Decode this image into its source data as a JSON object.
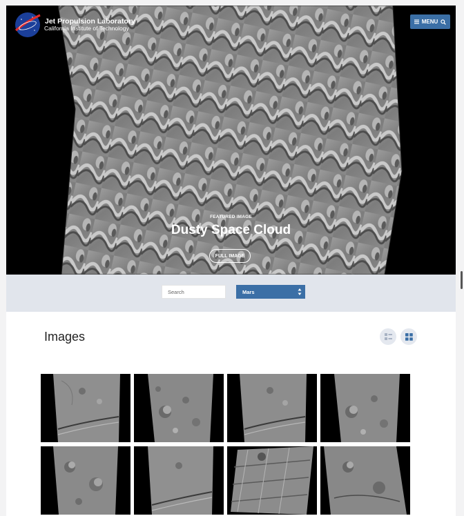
{
  "header": {
    "logo_title": "Jet Propulsion Laboratory",
    "logo_subtitle": "California Institute of Technology",
    "menu_label": "MENU",
    "menu_icon": "hamburger-icon",
    "search_icon": "search-icon"
  },
  "hero": {
    "eyebrow": "FEATURED IMAGE",
    "title": "Dusty Space Cloud",
    "button_label": "FULL IMAGE"
  },
  "filters": {
    "search_placeholder": "Search",
    "category_value": "Mars"
  },
  "images_section": {
    "title": "Images",
    "view_toggle": [
      "list-view-icon",
      "grid-view-icon"
    ],
    "thumbnails": [
      {
        "style": "strip-a"
      },
      {
        "style": "strip-b"
      },
      {
        "style": "strip-a"
      },
      {
        "style": "strip-b"
      },
      {
        "style": "strip-b"
      },
      {
        "style": "strip-a"
      },
      {
        "style": "tile-c"
      },
      {
        "style": "tile-d"
      }
    ]
  },
  "colors": {
    "accent": "#3b6fa6",
    "filter_bar": "#e1e5ec"
  }
}
